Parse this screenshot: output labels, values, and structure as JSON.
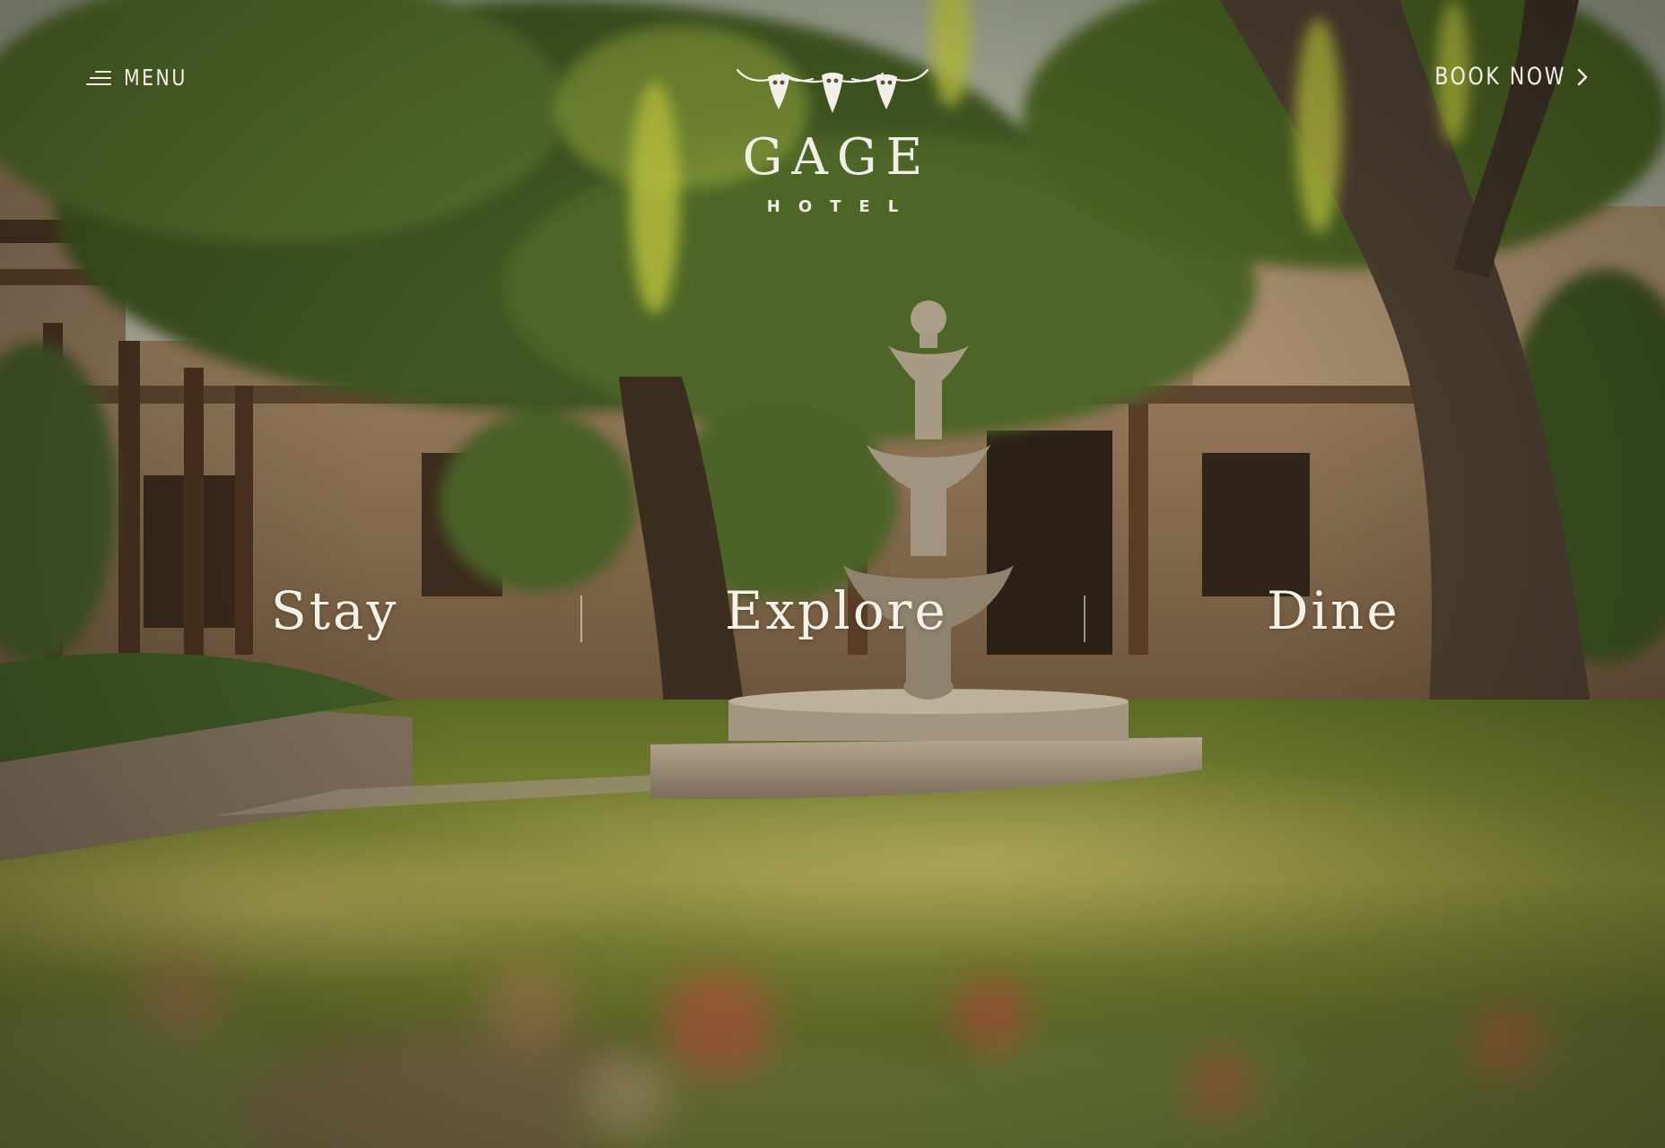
{
  "header": {
    "menu_label": "MENU",
    "book_label": "BOOK NOW"
  },
  "logo": {
    "name": "GAGE",
    "subtitle": "HOTEL",
    "icon": "longhorn-skulls-icon"
  },
  "nav": {
    "items": [
      {
        "label": "Stay"
      },
      {
        "label": "Explore"
      },
      {
        "label": "Dine"
      }
    ]
  },
  "hero": {
    "image": "courtyard-fountain-photo"
  },
  "colors": {
    "text": "#f4efe6",
    "overlay": "#2c2a1c"
  }
}
